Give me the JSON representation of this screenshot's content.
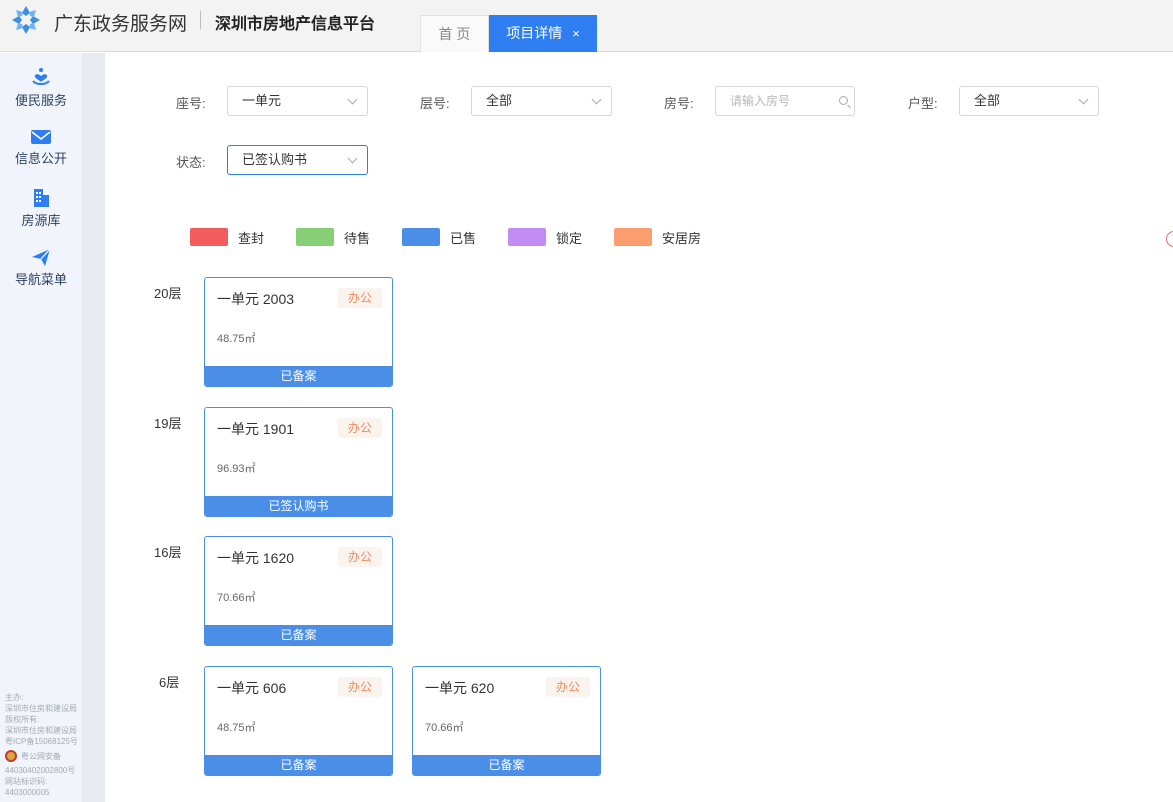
{
  "header": {
    "brand": "广东政务服务网",
    "platform": "深圳市房地产信息平台",
    "tabs": [
      {
        "label": "首 页"
      },
      {
        "label": "项目详情",
        "close": "×"
      }
    ]
  },
  "sidebar": {
    "items": [
      {
        "label": "便民服务",
        "icon": "heart-hand-icon"
      },
      {
        "label": "信息公开",
        "icon": "mail-icon"
      },
      {
        "label": "房源库",
        "icon": "building-icon"
      },
      {
        "label": "导航菜单",
        "icon": "paper-plane-icon"
      }
    ],
    "footer": {
      "line1": "主办:",
      "line2": "深圳市住房和建设局",
      "line3": "版权所有:",
      "line4": "深圳市住房和建设局",
      "line5": "粤ICP备15068125号",
      "police": "粤公网安备",
      "line6": "44030402002800号",
      "line7": "网站标识码:",
      "line8": "4403000005"
    }
  },
  "filters": {
    "building": {
      "label": "座号:",
      "value": "一单元"
    },
    "floor": {
      "label": "层号:",
      "value": "全部"
    },
    "room": {
      "label": "房号:",
      "placeholder": "请输入房号"
    },
    "layout": {
      "label": "户型:",
      "value": "全部"
    },
    "status": {
      "label": "状态:",
      "value": "已签认购书"
    }
  },
  "legend": [
    {
      "label": "查封",
      "color": "#f25c5c"
    },
    {
      "label": "待售",
      "color": "#86cf74"
    },
    {
      "label": "已售",
      "color": "#4a8ee8"
    },
    {
      "label": "锁定",
      "color": "#c28cf5"
    },
    {
      "label": "安居房",
      "color": "#fb9e6e"
    }
  ],
  "floors": [
    {
      "label": "20层",
      "units": [
        {
          "room": "一单元 2003",
          "usage": "办公",
          "area": "48.75㎡",
          "status": "已备案"
        }
      ]
    },
    {
      "label": "19层",
      "units": [
        {
          "room": "一单元 1901",
          "usage": "办公",
          "area": "96.93㎡",
          "status": "已签认购书"
        }
      ]
    },
    {
      "label": "16层",
      "units": [
        {
          "room": "一单元 1620",
          "usage": "办公",
          "area": "70.66㎡",
          "status": "已备案"
        }
      ]
    },
    {
      "label": "6层",
      "units": [
        {
          "room": "一单元 606",
          "usage": "办公",
          "area": "48.75㎡",
          "status": "已备案"
        },
        {
          "room": "一单元 620",
          "usage": "办公",
          "area": "70.66㎡",
          "status": "已备案"
        }
      ]
    }
  ]
}
